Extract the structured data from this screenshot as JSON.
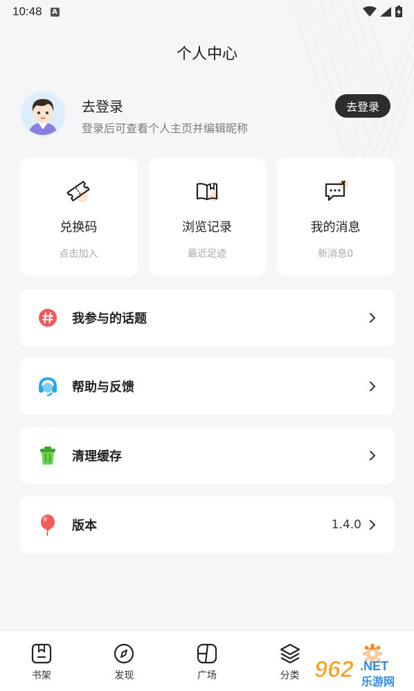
{
  "status": {
    "time": "10:48",
    "notif": "A"
  },
  "header": {
    "title": "个人中心"
  },
  "profile": {
    "name": "去登录",
    "subtitle": "登录后可查看个人主页并编辑昵称",
    "login_button": "去登录"
  },
  "cards": [
    {
      "title": "兑换码",
      "sub": "点击加入",
      "icon": "ticket-icon"
    },
    {
      "title": "浏览记录",
      "sub": "最近足迹",
      "icon": "book-icon"
    },
    {
      "title": "我的消息",
      "sub": "新消息0",
      "icon": "message-icon"
    }
  ],
  "rows": [
    {
      "label": "我参与的话题",
      "icon": "hashtag-icon",
      "color": "#f15a5a"
    },
    {
      "label": "帮助与反馈",
      "icon": "headset-icon",
      "color": "#27a6e8"
    },
    {
      "label": "清理缓存",
      "icon": "trash-icon",
      "color": "#5ac43c"
    },
    {
      "label": "版本",
      "value": "1.4.0",
      "icon": "balloon-icon",
      "color": "#f25c5c"
    }
  ],
  "tabs": [
    {
      "label": "书架",
      "icon": "bookshelf-icon"
    },
    {
      "label": "发现",
      "icon": "compass-icon"
    },
    {
      "label": "广场",
      "icon": "square-icon"
    },
    {
      "label": "分类",
      "icon": "layers-icon"
    },
    {
      "label": "",
      "icon": "settings-icon",
      "active_color": "#f28a1e"
    }
  ],
  "watermark": {
    "text": "962",
    "suffix": ".NET",
    "sub": "乐游网"
  }
}
